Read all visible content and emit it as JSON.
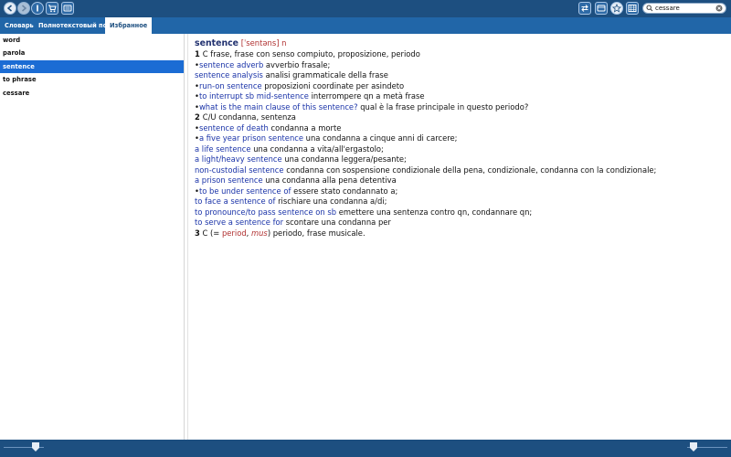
{
  "search": {
    "value": "cessare"
  },
  "tabs": [
    {
      "label": "Словарь"
    },
    {
      "label": "Полнотекстовый поиск"
    },
    {
      "label": "Избранное"
    }
  ],
  "sidebar": {
    "items": [
      {
        "label": "word"
      },
      {
        "label": "parola"
      },
      {
        "label": "sentence"
      },
      {
        "label": "to phrase"
      },
      {
        "label": "cessare"
      }
    ]
  },
  "entry": {
    "headword": "sentence",
    "transcription": "[ˈsentəns]",
    "pos": "n",
    "lines": [
      [
        "1 ",
        " C frase, frase con senso compiuto, proposizione, periodo"
      ],
      [
        "•",
        "sentence adverb",
        " avverbio frasale;"
      ],
      [
        "",
        "sentence analysis",
        " analisi grammaticale della frase"
      ],
      [
        "•",
        "run-on sentence",
        " proposizioni coordinate per asindeto"
      ],
      [
        "•",
        "to interrupt sb mid-sentence",
        " interrompere qn a metà frase"
      ],
      [
        "•",
        "what is the main clause of this sentence?",
        " qual è la frase principale in questo periodo?"
      ],
      [
        "2 ",
        " C/U condanna, sentenza"
      ],
      [
        "•",
        "sentence of death",
        " condanna a morte"
      ],
      [
        "•",
        "a five year prison sentence",
        " una condanna a cinque anni di carcere;"
      ],
      [
        "",
        "a life sentence",
        " una condanna a vita/all'ergastolo;"
      ],
      [
        "",
        "a light/heavy sentence",
        " una condanna leggera/pesante;"
      ],
      [
        "",
        "non-custodial sentence",
        " condanna con sospensione condizionale della pena, condizionale, condanna con la condizionale;"
      ],
      [
        "",
        "a prison sentence",
        " una condanna alla pena detentiva"
      ],
      [
        "•",
        "to be under sentence of",
        " essere stato condannato a;"
      ],
      [
        "",
        "to face a sentence of",
        " rischiare una condanna a/di;"
      ],
      [
        "",
        "to pronounce/to pass sentence on sb",
        " emettere una sentenza contro qn, condannare qn;"
      ],
      [
        "",
        "to serve a sentence for",
        " scontare una condanna per"
      ]
    ],
    "last": {
      "num": "3",
      "pre": " C (= ",
      "link": "period",
      "comma": ", ",
      "label": "mus",
      "post": ") periodo, frase musicale."
    }
  }
}
